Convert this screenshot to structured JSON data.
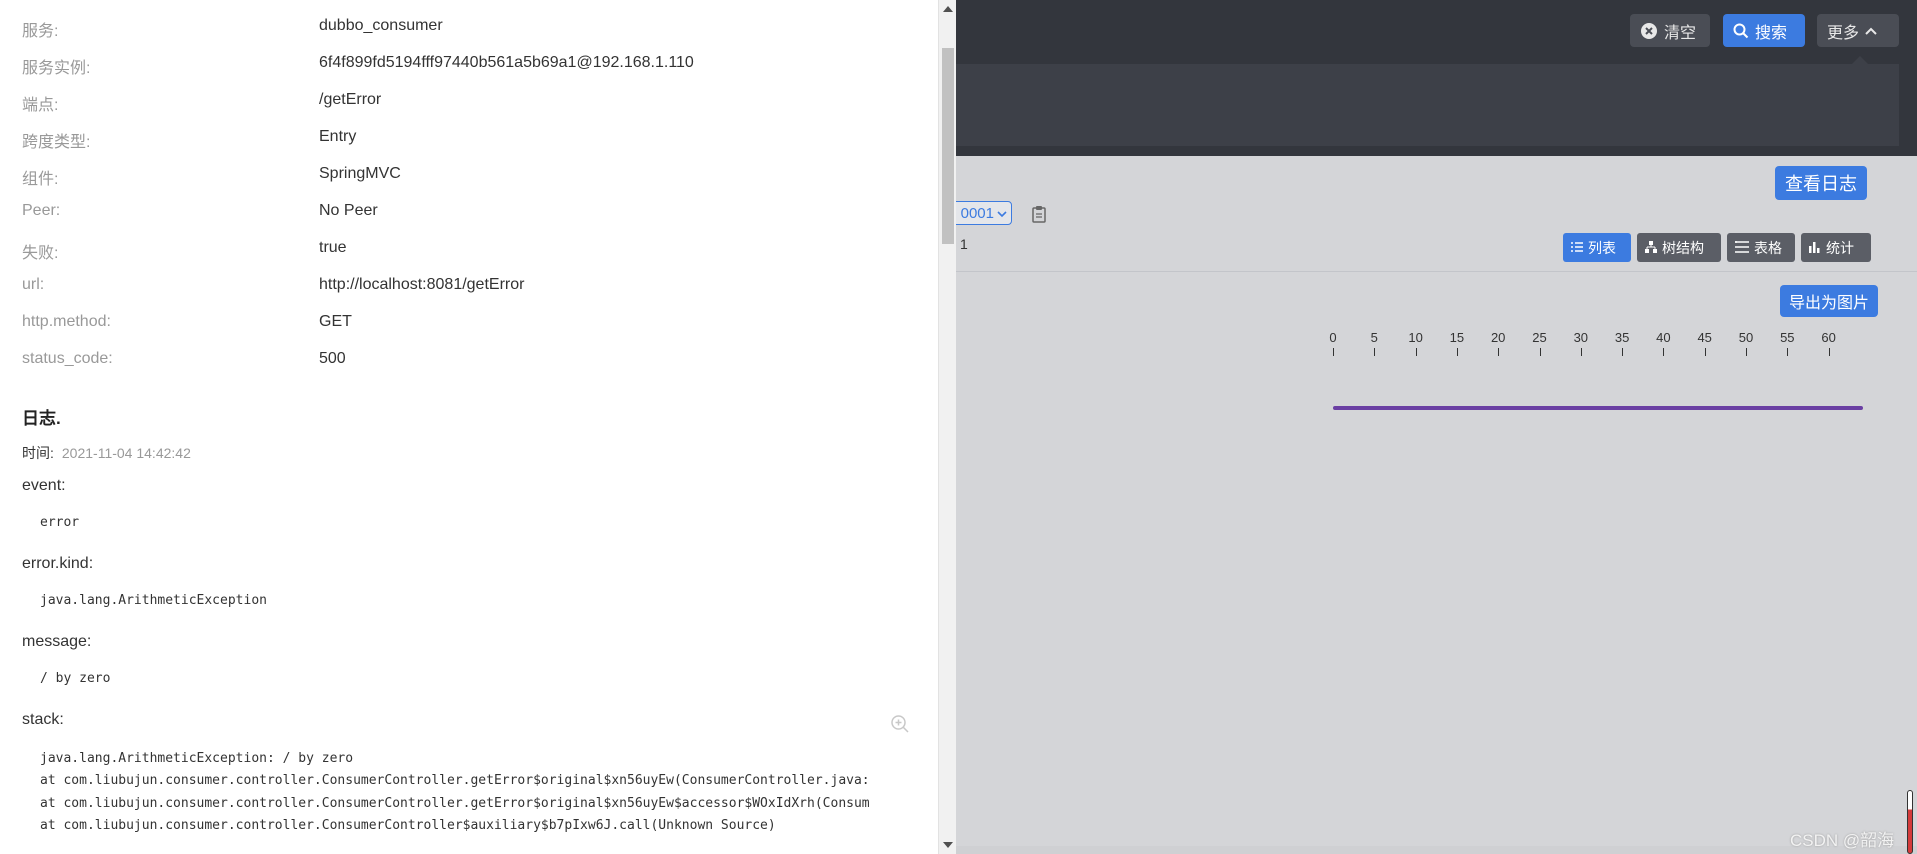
{
  "toolbar": {
    "clear_label": "清空",
    "search_label": "搜索",
    "more_label": "更多"
  },
  "trace": {
    "view_logs_label": "查看日志",
    "trace_id_suffix": "0001",
    "count_text": "1",
    "views": [
      {
        "label": "列表",
        "icon": "list-icon",
        "active": true
      },
      {
        "label": "树结构",
        "icon": "tree-icon",
        "active": false
      },
      {
        "label": "表格",
        "icon": "table-icon",
        "active": false
      },
      {
        "label": "统计",
        "icon": "bar-chart-icon",
        "active": false
      }
    ],
    "export_label": "导出为图片",
    "axis_ticks": [
      "0",
      "5",
      "10",
      "15",
      "20",
      "25",
      "30",
      "35",
      "40",
      "45",
      "50",
      "55",
      "60"
    ]
  },
  "detail": {
    "fields": [
      {
        "key": "服务:",
        "value": "dubbo_consumer"
      },
      {
        "key": "服务实例:",
        "value": "6f4f899fd5194fff97440b561a5b69a1@192.168.1.110"
      },
      {
        "key": "端点:",
        "value": "/getError"
      },
      {
        "key": "跨度类型:",
        "value": "Entry"
      },
      {
        "key": "组件:",
        "value": "SpringMVC"
      },
      {
        "key": "Peer:",
        "value": "No Peer"
      },
      {
        "key": "失败:",
        "value": "true"
      },
      {
        "key": "url:",
        "value": "http://localhost:8081/getError"
      },
      {
        "key": "http.method:",
        "value": "GET"
      },
      {
        "key": "status_code:",
        "value": "500"
      }
    ],
    "logs_title": "日志.",
    "time_label": "时间:",
    "time_value": "2021-11-04 14:42:42",
    "event_key": "event:",
    "event_value": "error",
    "error_kind_key": "error.kind:",
    "error_kind_value": "java.lang.ArithmeticException",
    "message_key": "message:",
    "message_value": "/ by zero",
    "stack_key": "stack:",
    "stack_lines": [
      "java.lang.ArithmeticException: / by zero",
      "at com.liubujun.consumer.controller.ConsumerController.getError$original$xn56uyEw(ConsumerController.java:",
      "at com.liubujun.consumer.controller.ConsumerController.getError$original$xn56uyEw$accessor$WOxIdXrh(Consum",
      "at com.liubujun.consumer.controller.ConsumerController$auxiliary$b7pIxw6J.call(Unknown Source)"
    ]
  },
  "watermark": "CSDN @韶海",
  "colors": {
    "primary": "#3c7be0",
    "dark_header": "#33363d",
    "span_bar": "#6a3fa3"
  }
}
